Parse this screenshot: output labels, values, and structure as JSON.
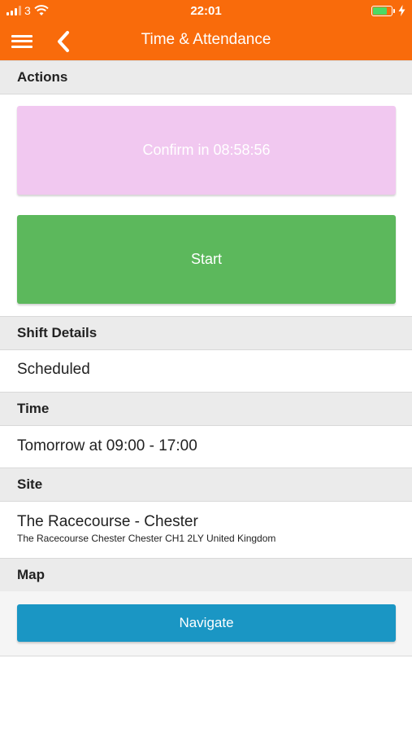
{
  "status_bar": {
    "carrier": "3",
    "time": "22:01",
    "battery_level": 0.75,
    "battery_color": "#4cd964"
  },
  "nav": {
    "title": "Time & Attendance",
    "menu_icon": "hamburger-menu-icon",
    "back_icon": "chevron-left-icon"
  },
  "colors": {
    "brand": "#f96b0b",
    "confirm": "#f1c8f0",
    "start": "#5cb85c",
    "navigate": "#1a96c4"
  },
  "sections": {
    "actions": "Actions",
    "shift_details": "Shift Details",
    "time": "Time",
    "site": "Site",
    "map": "Map"
  },
  "actions": {
    "confirm_label": "Confirm in 08:58:56",
    "start_label": "Start"
  },
  "shift": {
    "status": "Scheduled",
    "time": "Tomorrow at 09:00 - 17:00",
    "site_name": "The Racecourse - Chester",
    "site_address": "The Racecourse Chester Chester CH1 2LY United Kingdom"
  },
  "map": {
    "navigate_label": "Navigate"
  }
}
